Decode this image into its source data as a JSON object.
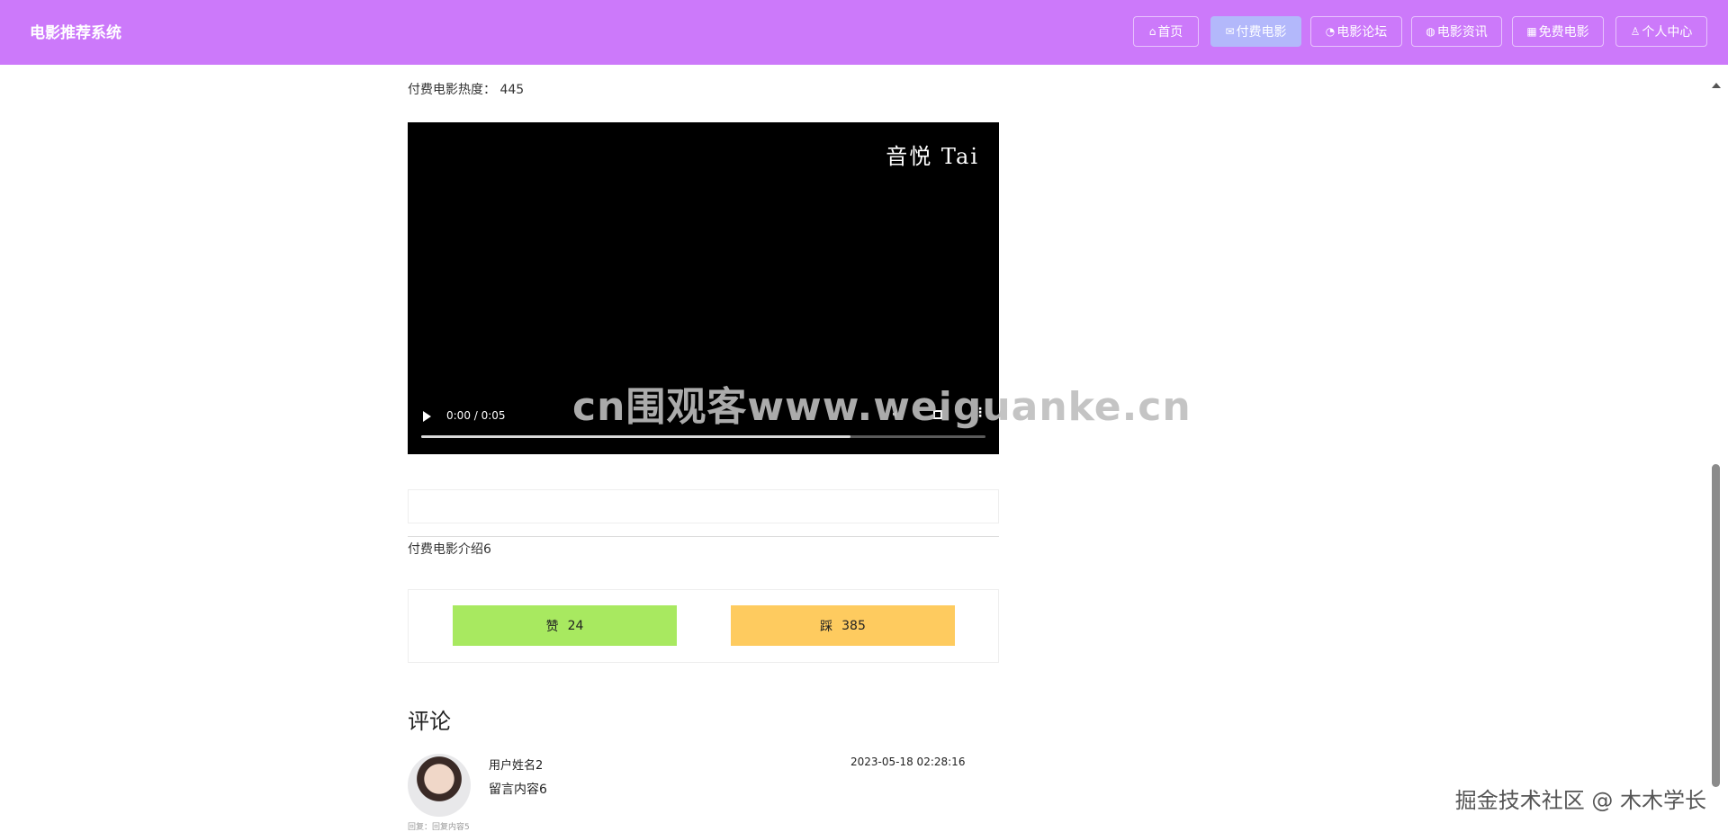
{
  "header": {
    "brand": "电影推荐系统",
    "bg_color": "#cc79fa",
    "active_color": "#b3b8fb",
    "nav": [
      {
        "label": "首页",
        "icon": "home-icon",
        "active": false
      },
      {
        "label": "付费电影",
        "icon": "mail-icon",
        "active": true
      },
      {
        "label": "电影论坛",
        "icon": "palette-icon",
        "active": false
      },
      {
        "label": "电影资讯",
        "icon": "globe-icon",
        "active": false
      },
      {
        "label": "免费电影",
        "icon": "film-icon",
        "active": false
      },
      {
        "label": "个人中心",
        "icon": "user-icon",
        "active": false
      }
    ]
  },
  "movie": {
    "hot_label": "付费电影热度： 445",
    "video": {
      "watermark": "音悦 Tai",
      "time": "0:00 / 0:05",
      "progress_fraction": 0.76
    },
    "intro": "付费电影介绍6",
    "like_label": "赞",
    "like_count": "24",
    "dislike_label": "踩",
    "dislike_count": "385"
  },
  "comments": {
    "title": "评论",
    "items": [
      {
        "user": "用户姓名2",
        "text": "留言内容6",
        "time": "2023-05-18 02:28:16",
        "reply_hint": "回复：回复内容5"
      }
    ]
  },
  "overlays": {
    "site_watermark": "cn围观客www.weiguanke.cn",
    "juejin_watermark": "掘金技术社区 @ 木木学长"
  }
}
